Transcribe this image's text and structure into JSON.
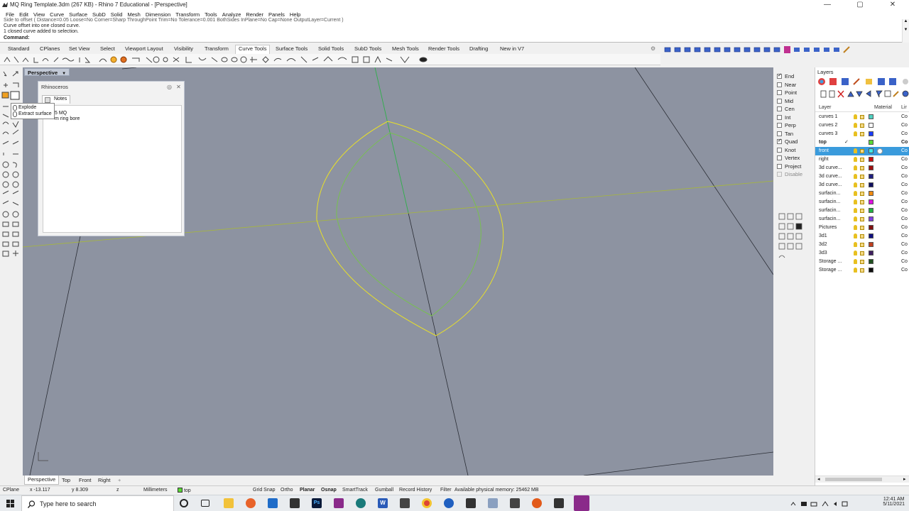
{
  "window": {
    "title": "MQ Ring Template.3dm (267 KB) - Rhino 7 Educational - [Perspective]",
    "minimize": "—",
    "maximize": "▢",
    "close": "✕"
  },
  "menu": [
    "File",
    "Edit",
    "View",
    "Curve",
    "Surface",
    "SubD",
    "Solid",
    "Mesh",
    "Dimension",
    "Transform",
    "Tools",
    "Analyze",
    "Render",
    "Panels",
    "Help"
  ],
  "command_history": {
    "line1": "Side to offset ( Distance=0.05  Loose=No  Corner=Sharp  ThroughPoint  Trim=No  Tolerance=0.001  BothSides  InPlane=No  Cap=None  OutputLayer=Current )",
    "line2": "Curve offset into one closed curve.",
    "line3": "1 closed curve added to selection.",
    "prompt": "Command:"
  },
  "toolbar_tabs": [
    "Standard",
    "CPlanes",
    "Set View",
    "Select",
    "Viewport Layout",
    "Visibility",
    "Transform",
    "Curve Tools",
    "Surface Tools",
    "Solid Tools",
    "SubD Tools",
    "Mesh Tools",
    "Render Tools",
    "Drafting",
    "New in V7"
  ],
  "active_toolbar_tab": "Curve Tools",
  "viewport": {
    "label": "Perspective",
    "menu_arrow": "▼"
  },
  "notes_panel": {
    "title": "Rhinoceros",
    "tab": "Notes",
    "text_line1": "5 MQ",
    "text_line2": "m ring bore"
  },
  "tooltip": {
    "line1": "Explode",
    "line2": "Extract surface"
  },
  "osnap": [
    {
      "label": "End",
      "checked": true,
      "disabled": false
    },
    {
      "label": "Near",
      "checked": false,
      "disabled": false
    },
    {
      "label": "Point",
      "checked": false,
      "disabled": false
    },
    {
      "label": "Mid",
      "checked": false,
      "disabled": false
    },
    {
      "label": "Cen",
      "checked": false,
      "disabled": false
    },
    {
      "label": "Int",
      "checked": false,
      "disabled": false
    },
    {
      "label": "Perp",
      "checked": false,
      "disabled": false
    },
    {
      "label": "Tan",
      "checked": false,
      "disabled": false
    },
    {
      "label": "Quad",
      "checked": true,
      "disabled": false
    },
    {
      "label": "Knot",
      "checked": false,
      "disabled": false
    },
    {
      "label": "Vertex",
      "checked": false,
      "disabled": false
    },
    {
      "label": "Project",
      "checked": false,
      "disabled": false
    },
    {
      "label": "Disable",
      "checked": false,
      "disabled": true
    }
  ],
  "layers_panel": {
    "title": "Layers",
    "col_layer": "Layer",
    "col_material": "Material",
    "col_linetype": "Lir",
    "current_mark": "✓",
    "rows": [
      {
        "name": "curves 1",
        "color": "#4fd0c0",
        "current": false,
        "selected": false,
        "linetype": "Co"
      },
      {
        "name": "curves 2",
        "color": "#ffffff",
        "current": false,
        "selected": false,
        "linetype": "Co"
      },
      {
        "name": "curves 3",
        "color": "#1a3cff",
        "current": false,
        "selected": false,
        "linetype": "Co"
      },
      {
        "name": "top",
        "color": "#5ad836",
        "current": true,
        "selected": false,
        "linetype": "Co"
      },
      {
        "name": "front",
        "color": "#3ee8e8",
        "current": false,
        "selected": true,
        "linetype": "Co"
      },
      {
        "name": "right",
        "color": "#cc1010",
        "current": false,
        "selected": false,
        "linetype": "Co"
      },
      {
        "name": "3d curve...",
        "color": "#a01010",
        "current": false,
        "selected": false,
        "linetype": "Co"
      },
      {
        "name": "3d curve...",
        "color": "#202080",
        "current": false,
        "selected": false,
        "linetype": "Co"
      },
      {
        "name": "3d curve...",
        "color": "#101060",
        "current": false,
        "selected": false,
        "linetype": "Co"
      },
      {
        "name": "surfacin...",
        "color": "#f08a10",
        "current": false,
        "selected": false,
        "linetype": "Co"
      },
      {
        "name": "surfacin...",
        "color": "#e010e0",
        "current": false,
        "selected": false,
        "linetype": "Co"
      },
      {
        "name": "surfacin...",
        "color": "#20b040",
        "current": false,
        "selected": false,
        "linetype": "Co"
      },
      {
        "name": "surfacin...",
        "color": "#8040e0",
        "current": false,
        "selected": false,
        "linetype": "Co"
      },
      {
        "name": "Pictures",
        "color": "#801010",
        "current": false,
        "selected": false,
        "linetype": "Co"
      },
      {
        "name": "3d1",
        "color": "#101080",
        "current": false,
        "selected": false,
        "linetype": "Co"
      },
      {
        "name": "3d2",
        "color": "#c04020",
        "current": false,
        "selected": false,
        "linetype": "Co"
      },
      {
        "name": "3d3",
        "color": "#402060",
        "current": false,
        "selected": false,
        "linetype": "Co"
      },
      {
        "name": "Storage ...",
        "color": "#205020",
        "current": false,
        "selected": false,
        "linetype": "Co"
      },
      {
        "name": "Storage ...",
        "color": "#101010",
        "current": false,
        "selected": false,
        "linetype": "Co"
      }
    ]
  },
  "viewport_tabs": [
    "Perspective",
    "Top",
    "Front",
    "Right"
  ],
  "viewport_tab_add": "+",
  "statusbar": {
    "cplane": "CPlane",
    "x": "x -13.117",
    "y": "y 8.309",
    "z": "z",
    "units": "Millimeters",
    "layer": "top",
    "grid_snap": "Grid Snap",
    "ortho": "Ortho",
    "planar": "Planar",
    "osnap": "Osnap",
    "smarttrack": "SmartTrack",
    "gumball": "Gumball",
    "record_history": "Record History",
    "filter": "Filter",
    "memory": "Available physical memory: 25462 MB"
  },
  "taskbar": {
    "search_placeholder": "Type here to search",
    "time": "12:41 AM",
    "date": "5/11/2021"
  }
}
